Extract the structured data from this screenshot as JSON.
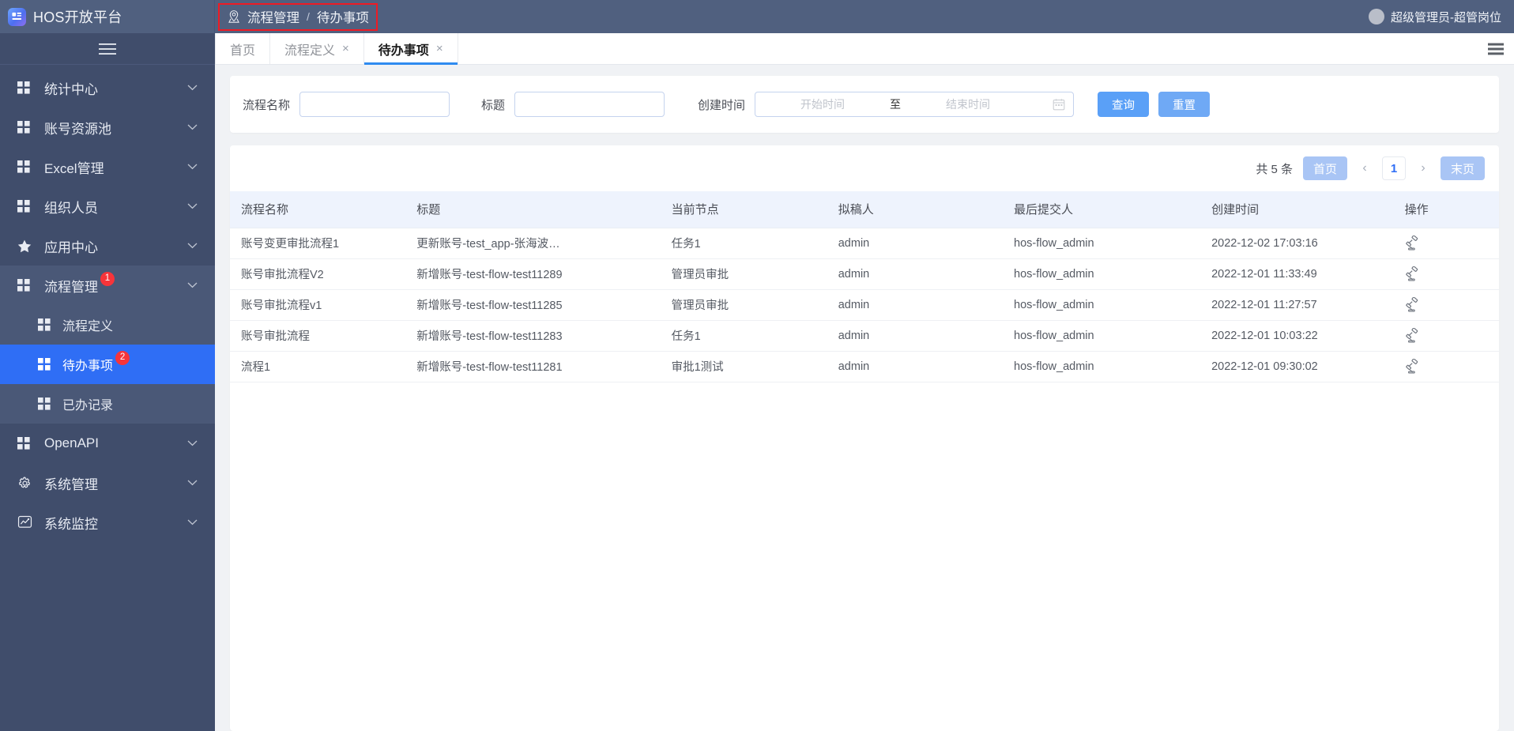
{
  "topbar": {
    "brand_title": "HOS开放平台",
    "brand_logo_icon": "app-logo-icon",
    "breadcrumb": {
      "icon": "location-pin-icon",
      "parent": "流程管理",
      "separator": "/",
      "current": "待办事项",
      "highlight_color": "#ee1b24"
    },
    "user": {
      "avatar_icon": "user-avatar",
      "name": "超级管理员-超管岗位"
    },
    "background_color": "#50607f"
  },
  "sidebar": {
    "collapse_icon": "hamburger-icon",
    "background_color": "#404d6b",
    "active_color": "#2f6ef5",
    "badge_color": "#f7343a",
    "items": [
      {
        "label": "统计中心",
        "icon": "grid-icon",
        "chevron": "chevron-down-icon",
        "badge": ""
      },
      {
        "label": "账号资源池",
        "icon": "grid-icon",
        "chevron": "chevron-down-icon",
        "badge": ""
      },
      {
        "label": "Excel管理",
        "icon": "grid-icon",
        "chevron": "chevron-down-icon",
        "badge": ""
      },
      {
        "label": "组织人员",
        "icon": "grid-icon",
        "chevron": "chevron-down-icon",
        "badge": ""
      },
      {
        "label": "应用中心",
        "icon": "star-icon",
        "chevron": "chevron-down-icon",
        "badge": ""
      },
      {
        "label": "流程管理",
        "icon": "grid-icon",
        "chevron": "chevron-down-icon",
        "badge": "1"
      }
    ],
    "submenu": [
      {
        "label": "流程定义",
        "icon": "grid-icon",
        "badge": "",
        "active": false
      },
      {
        "label": "待办事项",
        "icon": "grid-icon",
        "badge": "2",
        "active": true
      },
      {
        "label": "已办记录",
        "icon": "grid-icon",
        "badge": "",
        "active": false
      }
    ],
    "items_bottom": [
      {
        "label": "OpenAPI",
        "icon": "grid-icon",
        "chevron": "chevron-down-icon",
        "badge": ""
      },
      {
        "label": "系统管理",
        "icon": "gear-icon",
        "chevron": "chevron-down-icon",
        "badge": ""
      },
      {
        "label": "系统监控",
        "icon": "monitor-icon",
        "chevron": "chevron-down-icon",
        "badge": ""
      }
    ]
  },
  "tabbar": {
    "tabs": [
      {
        "label": "首页",
        "closable": false,
        "active": false
      },
      {
        "label": "流程定义",
        "closable": true,
        "active": false
      },
      {
        "label": "待办事项",
        "closable": true,
        "active": true
      }
    ],
    "close_glyph": "×",
    "menu_icon": "hamburger-icon",
    "active_underline_color": "#2f8bf0"
  },
  "filter": {
    "flow_name": {
      "label": "流程名称",
      "value": "",
      "placeholder": ""
    },
    "title": {
      "label": "标题",
      "value": "",
      "placeholder": ""
    },
    "create_time": {
      "label": "创建时间",
      "start_placeholder": "开始时间",
      "start_value": "",
      "separator": "至",
      "end_placeholder": "结束时间",
      "end_value": "",
      "calendar_icon": "calendar-icon"
    },
    "search_button": "查询",
    "reset_button": "重置",
    "search_color": "#5aa0f7",
    "reset_color": "#6fa9f5"
  },
  "pagination": {
    "total_text": "共 5 条",
    "first_page": "首页",
    "prev_icon": "chevron-left-icon",
    "current_page": "1",
    "next_icon": "chevron-right-icon",
    "last_page": "末页"
  },
  "table": {
    "headers": [
      "流程名称",
      "标题",
      "当前节点",
      "拟稿人",
      "最后提交人",
      "创建时间",
      "操作"
    ],
    "action_icon": "gavel-approve-icon",
    "rows": [
      {
        "flow_name": "账号变更审批流程1",
        "title": "更新账号-test_app-张海波…",
        "node": "任务1",
        "drafter": "admin",
        "submitter": "hos-flow_admin",
        "create_time": "2022-12-02 17:03:16"
      },
      {
        "flow_name": "账号审批流程V2",
        "title": "新增账号-test-flow-test11289",
        "node": "管理员审批",
        "drafter": "admin",
        "submitter": "hos-flow_admin",
        "create_time": "2022-12-01 11:33:49"
      },
      {
        "flow_name": "账号审批流程v1",
        "title": "新增账号-test-flow-test11285",
        "node": "管理员审批",
        "drafter": "admin",
        "submitter": "hos-flow_admin",
        "create_time": "2022-12-01 11:27:57"
      },
      {
        "flow_name": "账号审批流程",
        "title": "新增账号-test-flow-test11283",
        "node": "任务1",
        "drafter": "admin",
        "submitter": "hos-flow_admin",
        "create_time": "2022-12-01 10:03:22"
      },
      {
        "flow_name": "流程1",
        "title": "新增账号-test-flow-test11281",
        "node": "审批1测试",
        "drafter": "admin",
        "submitter": "hos-flow_admin",
        "create_time": "2022-12-01 09:30:02"
      }
    ]
  }
}
